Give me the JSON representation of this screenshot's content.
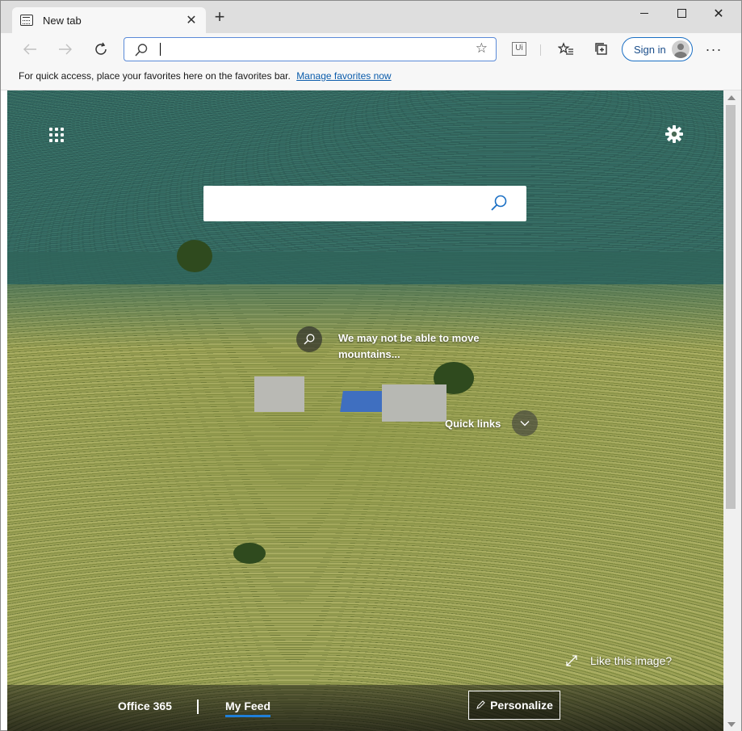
{
  "browser": {
    "tab": {
      "title": "New tab",
      "close_glyph": "✕"
    },
    "new_tab_glyph": "+",
    "window_controls": {
      "close_glyph": "✕"
    },
    "toolbar": {
      "address_value": "",
      "address_placeholder": "",
      "favorite_star_glyph": "☆",
      "extension_label": "Ui",
      "sign_in_label": "Sign in",
      "more_glyph": "···"
    },
    "favorites_bar": {
      "message": "For quick access, place your favorites here on the favorites bar.",
      "link": "Manage favorites now"
    }
  },
  "newtab": {
    "search": {
      "value": "",
      "placeholder": ""
    },
    "image_caption": "We may not be able to move mountains...",
    "quick_links_label": "Quick links",
    "like_image_label": "Like this image?",
    "feed": {
      "tabs": [
        {
          "label": "Office 365"
        },
        {
          "label": "My Feed",
          "active": true
        }
      ],
      "personalize_label": "Personalize"
    }
  },
  "colors": {
    "accent": "#1f7fd8",
    "address_border": "#5a8ad8",
    "link": "#0b5cab"
  },
  "icons": [
    "tab-icon",
    "back-icon",
    "forward-icon",
    "refresh-icon",
    "search-icon",
    "star-icon",
    "collections-icon",
    "favorites-list-icon",
    "apps-launcher-icon",
    "gear-icon",
    "chevron-down-icon",
    "expand-icon",
    "pencil-icon"
  ]
}
